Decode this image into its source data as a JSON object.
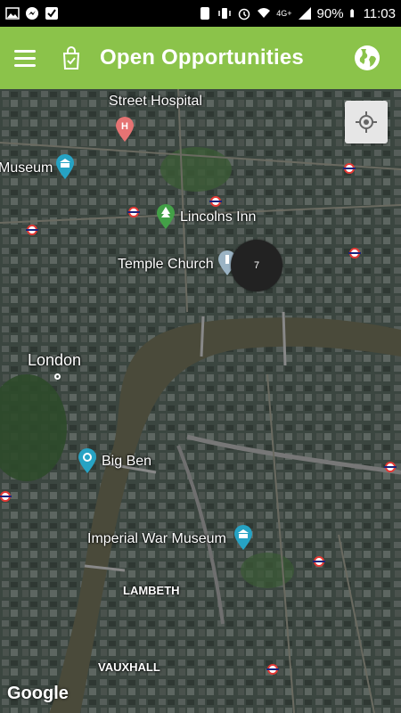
{
  "status_bar": {
    "battery": "90%",
    "time": "11:03",
    "network": "4G+"
  },
  "app_bar": {
    "title": "Open Opportunities",
    "icons": [
      "menu-icon",
      "shopping-bag-check-icon",
      "globe-icon"
    ]
  },
  "map": {
    "labels": {
      "street_hospital": "Street Hospital",
      "museum": "Museum",
      "lincolns_inn": "Lincolns Inn",
      "temple_church": "Temple Church",
      "london": "London",
      "big_ben": "Big Ben",
      "imperial_war_museum": "Imperial War Museum",
      "lambeth": "LAMBETH",
      "vauxhall": "VAUXHALL"
    },
    "cluster_count": "7",
    "attribution": "Google",
    "colors": {
      "accent": "#8bc34a",
      "museum_pin": "#26a3c4",
      "hospital_pin": "#e57373",
      "park_pin": "#43a047"
    }
  }
}
